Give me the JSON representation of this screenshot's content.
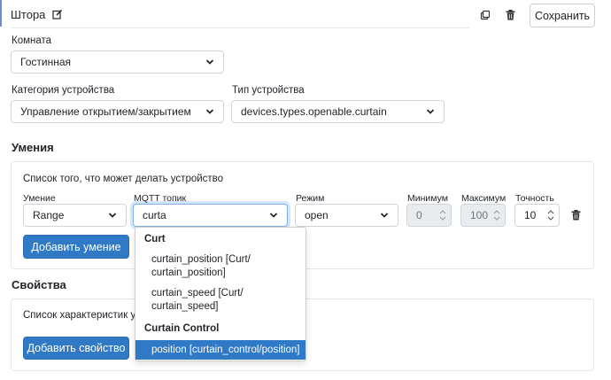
{
  "header": {
    "title": "Штора",
    "save_label": "Сохранить"
  },
  "room": {
    "label": "Комната",
    "value": "Гостинная"
  },
  "device_category": {
    "label": "Категория устройства",
    "value": "Управление открытием/закрытием"
  },
  "device_type": {
    "label": "Тип устройства",
    "value": "devices.types.openable.curtain"
  },
  "skills": {
    "title": "Умения",
    "description": "Список того, что может делать устройство",
    "col_skill": "Умение",
    "col_mqtt": "MQTT топик",
    "col_mode": "Режим",
    "col_min": "Минимум",
    "col_max": "Максимум",
    "col_precision": "Точность",
    "skill_value": "Range",
    "mqtt_value": "curta",
    "mode_value": "open",
    "min_value": "0",
    "max_value": "100",
    "precision_value": "10",
    "add_label": "Добавить умение"
  },
  "properties": {
    "title": "Свойства",
    "description": "Список характеристик устр",
    "add_label": "Добавить свойство"
  },
  "dropdown": {
    "group1": "Curt",
    "opt1_line1": "curtain_position [Curt/",
    "opt1_line2": "curtain_position]",
    "opt2_line1": "curtain_speed [Curt/",
    "opt2_line2": "curtain_speed]",
    "group2": "Curtain Control",
    "opt3": "position [curtain_control/position]"
  },
  "colors": {
    "primary": "#2f79c6",
    "focus": "#7fb0e6"
  },
  "icons": [
    "edit-icon",
    "copy-icon",
    "trash-icon",
    "chevron-down-icon",
    "spinner-icon"
  ]
}
